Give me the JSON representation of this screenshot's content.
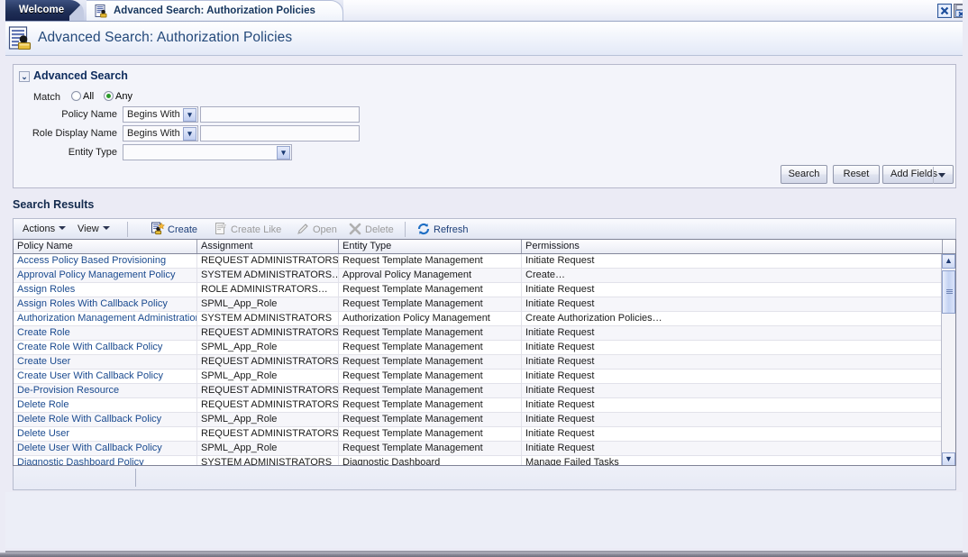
{
  "window": {
    "close_label": "✖",
    "save_label": "■",
    "close_icon": "close-icon",
    "save_icon": "save-icon"
  },
  "tabs": [
    {
      "label": "Welcome",
      "active": false,
      "icon": ""
    },
    {
      "label": "Advanced Search: Authorization Policies",
      "active": true,
      "icon": "policy-document-icon"
    }
  ],
  "header": {
    "title": "Advanced Search: Authorization Policies",
    "icon": "policy-document-lock-icon"
  },
  "advanced_search": {
    "panel_title": "Advanced Search",
    "twisty": "⌄",
    "match_label": "Match",
    "match_options": [
      {
        "label": "All",
        "selected": false
      },
      {
        "label": "Any",
        "selected": true
      }
    ],
    "fields": [
      {
        "label": "Policy Name",
        "operator": "Begins With",
        "value": "",
        "placeholder": ""
      },
      {
        "label": "Role Display Name",
        "operator": "Begins With",
        "value": "",
        "placeholder": ""
      }
    ],
    "entity_type": {
      "label": "Entity Type",
      "value": "",
      "placeholder": ""
    },
    "buttons": {
      "search": "Search",
      "reset": "Reset",
      "add_fields": "Add Fields"
    }
  },
  "results": {
    "title": "Search Results",
    "toolbar": [
      {
        "name": "actions",
        "label": "Actions",
        "menu": true,
        "disabled": false,
        "icon": ""
      },
      {
        "name": "view",
        "label": "View",
        "menu": true,
        "disabled": false,
        "icon": ""
      },
      {
        "name": "create",
        "label": "Create",
        "menu": false,
        "disabled": false,
        "icon": "create-icon"
      },
      {
        "name": "create-like",
        "label": "Create Like",
        "menu": false,
        "disabled": true,
        "icon": "create-like-icon"
      },
      {
        "name": "open",
        "label": "Open",
        "menu": false,
        "disabled": true,
        "icon": "pencil-icon"
      },
      {
        "name": "delete",
        "label": "Delete",
        "menu": false,
        "disabled": true,
        "icon": "delete-x-icon"
      },
      {
        "name": "refresh",
        "label": "Refresh",
        "menu": false,
        "disabled": false,
        "icon": "refresh-icon"
      }
    ],
    "columns": [
      "Policy Name",
      "Assignment",
      "Entity Type",
      "Permissions"
    ],
    "rows": [
      [
        "Access Policy Based Provisioning",
        "REQUEST ADMINISTRATORS",
        "Request Template Management",
        "Initiate Request"
      ],
      [
        "Approval Policy Management Policy",
        "SYSTEM ADMINISTRATORS…",
        "Approval Policy Management",
        "Create…"
      ],
      [
        "Assign Roles",
        "ROLE ADMINISTRATORS…",
        "Request Template Management",
        "Initiate Request"
      ],
      [
        "Assign Roles With Callback Policy",
        "SPML_App_Role",
        "Request Template Management",
        "Initiate Request"
      ],
      [
        "Authorization Management Administration",
        "SYSTEM ADMINISTRATORS",
        "Authorization Policy Management",
        "Create Authorization Policies…"
      ],
      [
        "Create Role",
        "REQUEST ADMINISTRATORS",
        "Request Template Management",
        "Initiate Request"
      ],
      [
        "Create Role With Callback Policy",
        "SPML_App_Role",
        "Request Template Management",
        "Initiate Request"
      ],
      [
        "Create User",
        "REQUEST ADMINISTRATORS",
        "Request Template Management",
        "Initiate Request"
      ],
      [
        "Create User With Callback Policy",
        "SPML_App_Role",
        "Request Template Management",
        "Initiate Request"
      ],
      [
        "De-Provision Resource",
        "REQUEST ADMINISTRATORS",
        "Request Template Management",
        "Initiate Request"
      ],
      [
        "Delete Role",
        "REQUEST ADMINISTRATORS",
        "Request Template Management",
        "Initiate Request"
      ],
      [
        "Delete Role With Callback Policy",
        "SPML_App_Role",
        "Request Template Management",
        "Initiate Request"
      ],
      [
        "Delete User",
        "REQUEST ADMINISTRATORS",
        "Request Template Management",
        "Initiate Request"
      ],
      [
        "Delete User With Callback Policy",
        "SPML_App_Role",
        "Request Template Management",
        "Initiate Request"
      ],
      [
        "Diagnostic Dashboard Policy",
        "SYSTEM ADMINISTRATORS",
        "Diagnostic Dashboard",
        "Manage Failed Tasks"
      ]
    ],
    "scrollbar": {
      "up": "▲",
      "down": "▼"
    }
  },
  "colors": {
    "accent": "#1a4a8f",
    "tab_active_text": "#16365e",
    "tab_inactive_bg": "#1f2f57",
    "panel_bg": "#f3f4fa",
    "page_bg": "#eceef7",
    "radio_selected": "#2a9a2a"
  }
}
